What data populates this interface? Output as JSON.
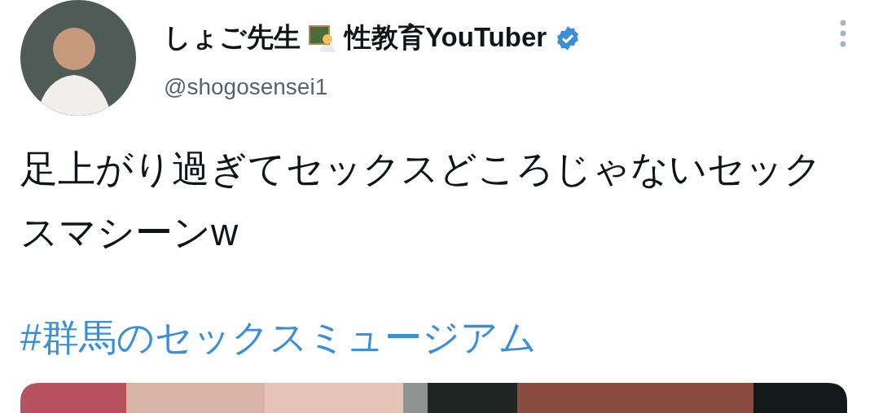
{
  "author": {
    "name": "しょご先生",
    "title": "性教育YouTuber",
    "verified": true,
    "handle": "@shogosensei1"
  },
  "tweet": {
    "text": "足上がり過ぎてセックスどころじゃないセックスマシーンw",
    "hashtag": "#群馬のセックスミュージアム"
  }
}
